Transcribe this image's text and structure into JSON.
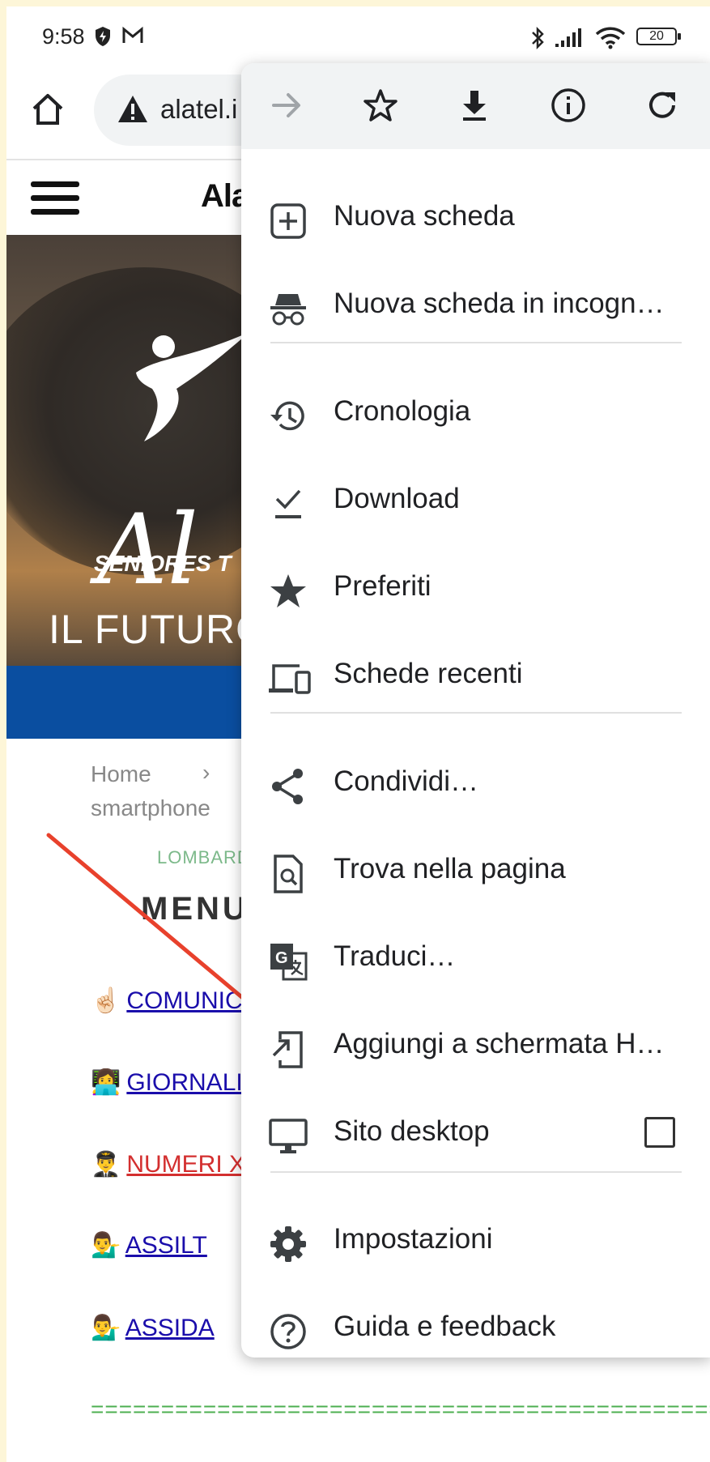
{
  "status_bar": {
    "time": "9:58",
    "battery": "20"
  },
  "omnibox": {
    "url": "alatel.i"
  },
  "site": {
    "title": "Ala"
  },
  "hero": {
    "brand": "Al",
    "tagline": "SENIORES T",
    "headline": "IL FUTURO"
  },
  "breadcrumb": {
    "home": "Home",
    "sep": "›",
    "current": "smartphone"
  },
  "page": {
    "region": "LOMBARD",
    "menu_title": "MENU",
    "links": [
      {
        "emoji": "☝🏻",
        "text": "COMUNIC",
        "color": "#1a0dab"
      },
      {
        "emoji": "👩‍💻",
        "text": "GIORNALI",
        "color": "#1a0dab"
      },
      {
        "emoji": "👨‍✈️",
        "text": "NUMERI X",
        "color": "#d32f2f"
      },
      {
        "emoji": "💁‍♂️",
        "text": "ASSILT",
        "color": "#1a0dab"
      },
      {
        "emoji": "💁‍♂️",
        "text": "ASSIDA",
        "color": "#1a0dab"
      }
    ],
    "separator": "================================================"
  },
  "menu": {
    "top_icons": [
      "forward-arrow-icon",
      "star-outline-icon",
      "download-icon",
      "info-icon",
      "refresh-icon"
    ],
    "items": [
      {
        "label": "Nuova scheda",
        "icon": "plus-box-icon"
      },
      {
        "label": "Nuova scheda in incogn…",
        "icon": "incognito-icon"
      },
      {
        "label": "Cronologia",
        "icon": "history-icon"
      },
      {
        "label": "Download",
        "icon": "download-check-icon"
      },
      {
        "label": "Preferiti",
        "icon": "star-filled-icon"
      },
      {
        "label": "Schede recenti",
        "icon": "devices-icon"
      },
      {
        "label": "Condividi…",
        "icon": "share-icon"
      },
      {
        "label": "Trova nella pagina",
        "icon": "find-in-page-icon"
      },
      {
        "label": "Traduci…",
        "icon": "translate-icon"
      },
      {
        "label": "Aggiungi a schermata H…",
        "icon": "add-to-home-icon"
      },
      {
        "label": "Sito desktop",
        "icon": "desktop-icon"
      },
      {
        "label": "Impostazioni",
        "icon": "gear-icon"
      },
      {
        "label": "Guida e feedback",
        "icon": "help-icon"
      }
    ]
  },
  "colors": {
    "accent_blue": "#0a4ea0",
    "link": "#1a0dab",
    "arrow": "#e8412c"
  }
}
